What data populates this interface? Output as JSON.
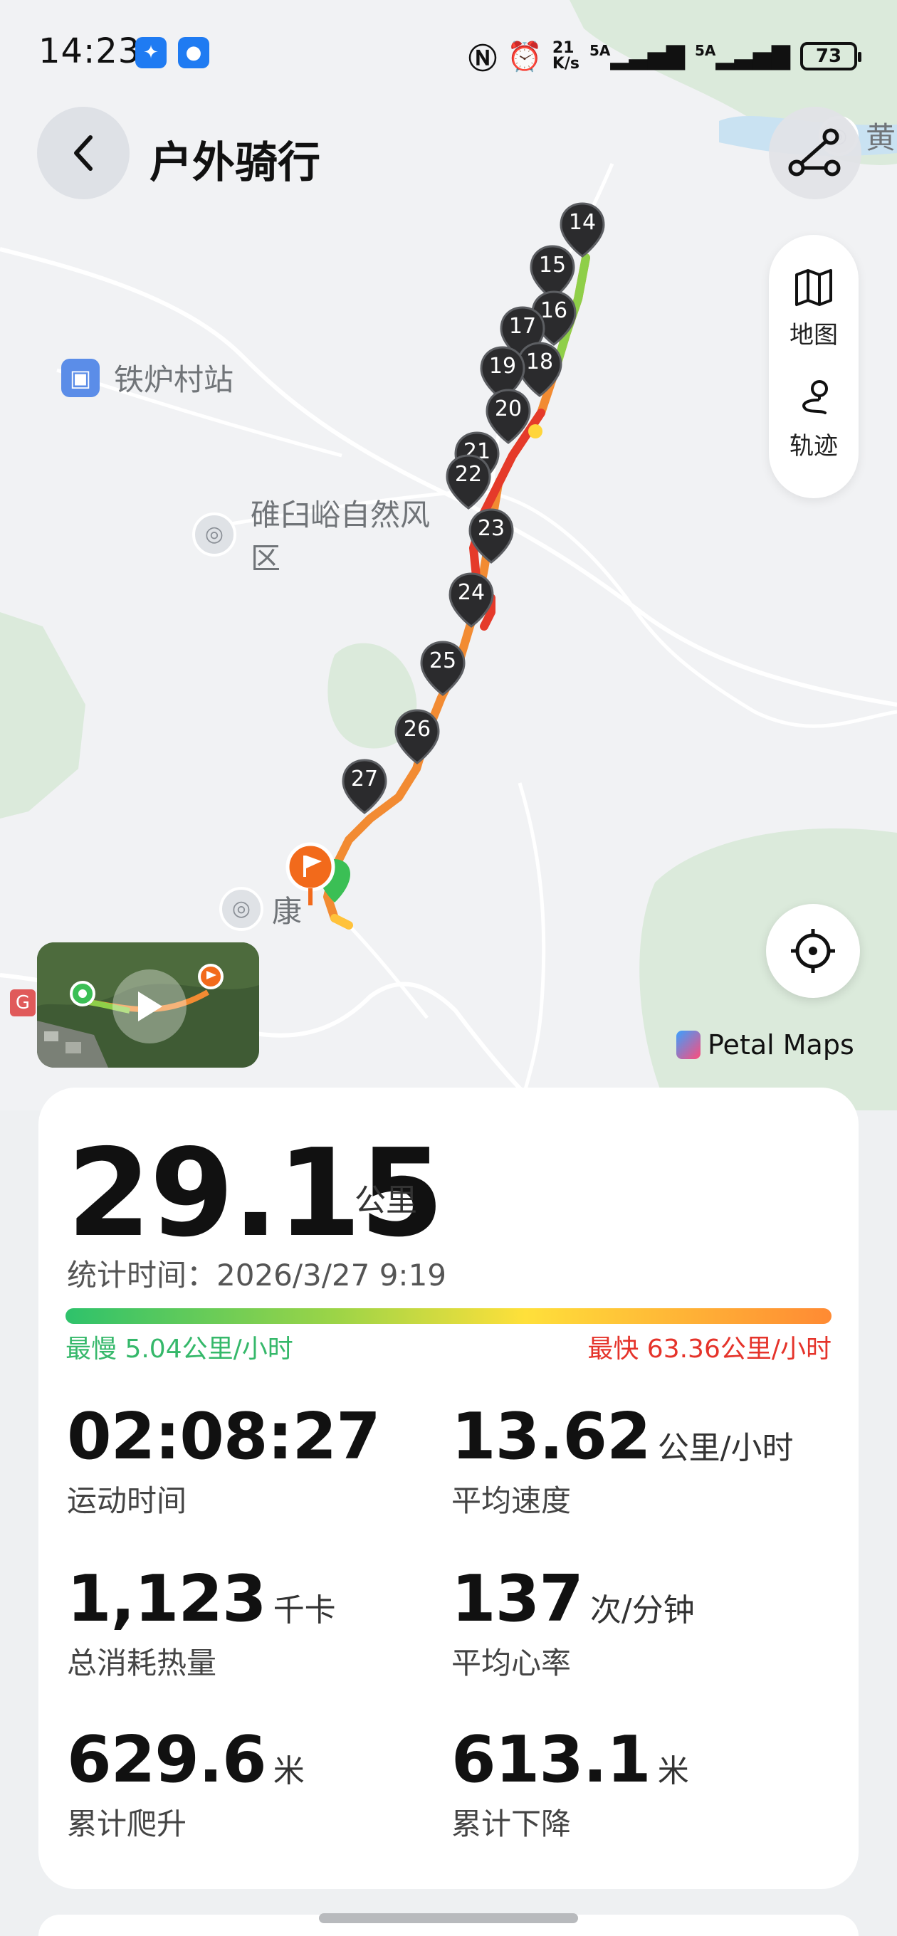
{
  "status_bar": {
    "time": "14:23",
    "network_speed": "21\nK/s",
    "sim1": "5A",
    "sim2": "5A",
    "battery": "73"
  },
  "header": {
    "title": "户外骑行"
  },
  "map": {
    "labels": {
      "station": "铁炉村站",
      "scenic_line1": "碓臼峪自然风",
      "scenic_line2": "区",
      "town": "康",
      "top_right": "黄"
    },
    "km_markers": [
      "14",
      "15",
      "16",
      "17",
      "18",
      "19",
      "20",
      "21",
      "22",
      "23",
      "24",
      "25",
      "26",
      "27"
    ],
    "side_panel": {
      "map_label": "地图",
      "track_label": "轨迹"
    },
    "attribution": "Petal Maps",
    "road_badge": "G"
  },
  "summary": {
    "distance": "29.15",
    "distance_unit": "公里",
    "stat_time": "统计时间：2026/3/27 9:19",
    "slowest": "最慢 5.04公里/小时",
    "fastest": "最快 63.36公里/小时",
    "metrics": [
      {
        "value": "02:08:27",
        "unit": "",
        "label": "运动时间"
      },
      {
        "value": "13.62",
        "unit": "公里/小时",
        "label": "平均速度"
      },
      {
        "value": "1,123",
        "unit": "千卡",
        "label": "总消耗热量"
      },
      {
        "value": "137",
        "unit": "次/分钟",
        "label": "平均心率"
      },
      {
        "value": "629.6",
        "unit": "米",
        "label": "累计爬升"
      },
      {
        "value": "613.1",
        "unit": "米",
        "label": "累计下降"
      }
    ]
  },
  "colors": {
    "slow": "#35b86a",
    "fast": "#e5332a",
    "accent_orange": "#f26a1b",
    "start_green": "#3bbf55"
  }
}
